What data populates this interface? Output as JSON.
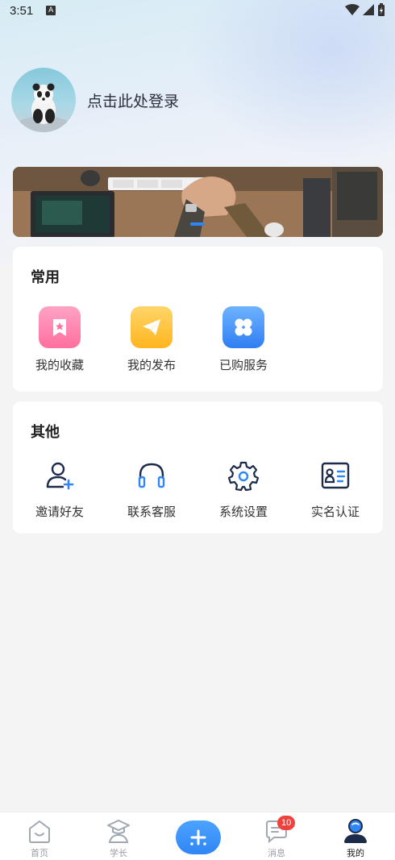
{
  "status_bar": {
    "time": "3:51",
    "indicator": "A"
  },
  "profile": {
    "login_prompt": "点击此处登录",
    "avatar_icon": "panda-avatar"
  },
  "banner": {
    "image": "teamwork-hands-photo",
    "active_dot": 1
  },
  "common": {
    "title": "常用",
    "items": [
      {
        "label": "我的收藏",
        "icon": "favorite-star-icon",
        "color": "#ff6fa0"
      },
      {
        "label": "我的发布",
        "icon": "paper-plane-icon",
        "color": "#ffbe2e"
      },
      {
        "label": "已购服务",
        "icon": "four-petal-grid-icon",
        "color": "#3f8dfb"
      }
    ]
  },
  "other": {
    "title": "其他",
    "items": [
      {
        "label": "邀请好友",
        "icon": "add-user-icon"
      },
      {
        "label": "联系客服",
        "icon": "headset-icon"
      },
      {
        "label": "系统设置",
        "icon": "gear-icon"
      },
      {
        "label": "实名认证",
        "icon": "id-card-icon"
      }
    ]
  },
  "tabbar": {
    "items": [
      {
        "label": "首页",
        "icon": "home-smile-icon",
        "active": false
      },
      {
        "label": "学长",
        "icon": "graduate-icon",
        "active": false
      },
      {
        "label": "",
        "icon": "plus-icon",
        "active": false
      },
      {
        "label": "消息",
        "icon": "message-icon",
        "active": false,
        "badge": "10"
      },
      {
        "label": "我的",
        "icon": "profile-icon",
        "active": true
      }
    ]
  },
  "colors": {
    "accent": "#2f86f5",
    "badge": "#f0413c"
  }
}
